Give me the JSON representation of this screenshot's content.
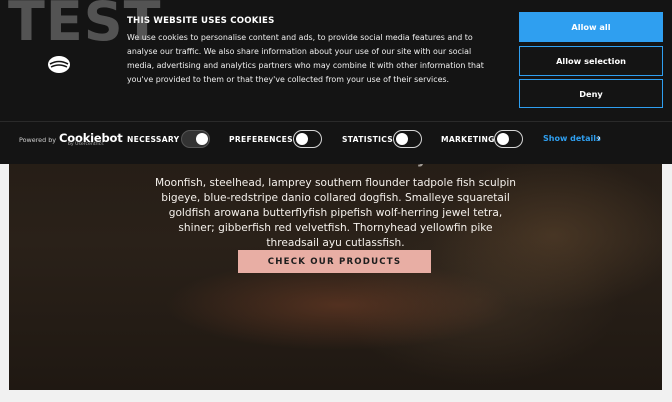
{
  "site": {
    "logo_text": "TEST"
  },
  "hero": {
    "tagline": "Classified Perfectly",
    "body": "Moonfish, steelhead, lamprey southern flounder tadpole fish sculpin bigeye, blue-redstripe danio collared dogfish. Smalleye squaretail goldfish arowana butterflyfish pipefish wolf-herring jewel tetra, shiner; gibberfish red velvetfish. Thornyhead yellowfin pike threadsail ayu cutlassfish.",
    "button_label": "CHECK OUR PRODUCTS"
  },
  "cookie_banner": {
    "icon": "cookie-icon",
    "title": "THIS WEBSITE USES COOKIES",
    "body": "We use cookies to personalise content and ads, to provide social media features and to analyse our traffic. We also share information about your use of our site with our social media, advertising and analytics partners who may combine it with other information that you've provided to them or that they've collected from your use of their services.",
    "buttons": {
      "allow_all": "Allow all",
      "allow_selection": "Allow selection",
      "deny": "Deny"
    },
    "powered_by": "Powered by",
    "brand": "Cookiebot",
    "brand_sub": "by Usercentrics",
    "toggles": [
      {
        "label": "NECESSARY",
        "state": "on"
      },
      {
        "label": "PREFERENCES",
        "state": "off"
      },
      {
        "label": "STATISTICS",
        "state": "off"
      },
      {
        "label": "MARKETING",
        "state": "off"
      }
    ],
    "show_details": "Show details",
    "accent_color": "#2f9ff0"
  }
}
